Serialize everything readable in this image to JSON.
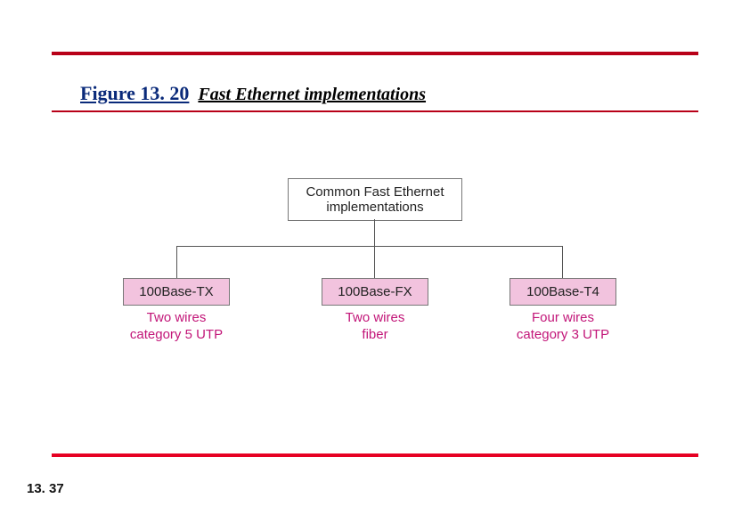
{
  "figure": {
    "label": "Figure 13. 20",
    "caption": "Fast Ethernet implementations"
  },
  "diagram": {
    "root": "Common Fast Ethernet implementations",
    "leaves": [
      {
        "name": "100Base-TX",
        "caption_l1": "Two wires",
        "caption_l2": "category 5 UTP"
      },
      {
        "name": "100Base-FX",
        "caption_l1": "Two wires",
        "caption_l2": "fiber"
      },
      {
        "name": "100Base-T4",
        "caption_l1": "Four  wires",
        "caption_l2": "category 3 UTP"
      }
    ]
  },
  "page": "13. 37"
}
